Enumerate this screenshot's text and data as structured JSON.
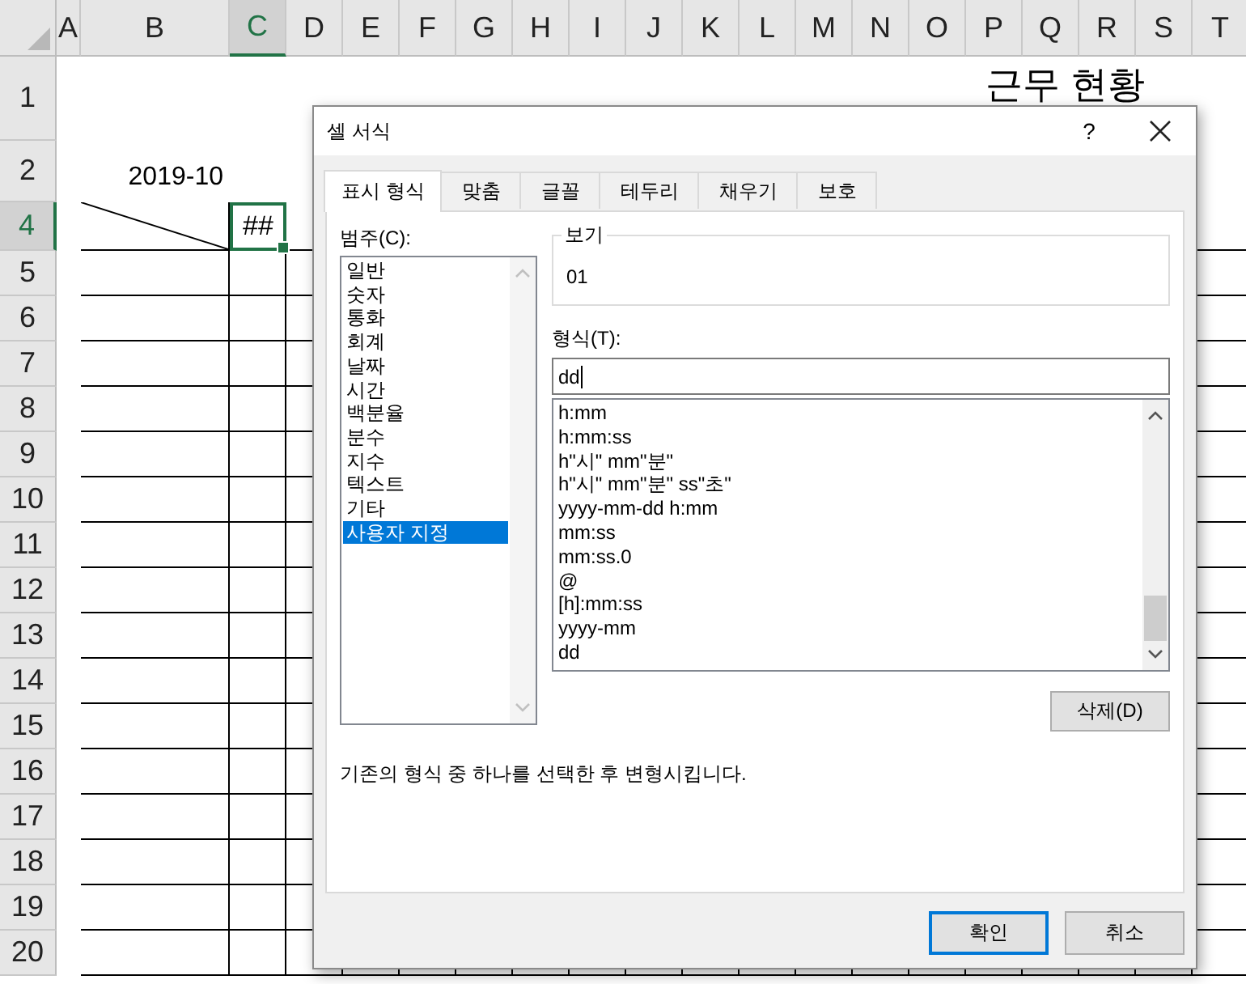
{
  "sheet": {
    "columns": [
      {
        "label": "A",
        "selected": false
      },
      {
        "label": "B",
        "selected": false
      },
      {
        "label": "C",
        "selected": true
      },
      {
        "label": "D",
        "selected": false
      },
      {
        "label": "E",
        "selected": false
      },
      {
        "label": "F",
        "selected": false
      },
      {
        "label": "G",
        "selected": false
      },
      {
        "label": "H",
        "selected": false
      },
      {
        "label": "I",
        "selected": false
      },
      {
        "label": "J",
        "selected": false
      },
      {
        "label": "K",
        "selected": false
      },
      {
        "label": "L",
        "selected": false
      },
      {
        "label": "M",
        "selected": false
      },
      {
        "label": "N",
        "selected": false
      },
      {
        "label": "O",
        "selected": false
      },
      {
        "label": "P",
        "selected": false
      },
      {
        "label": "Q",
        "selected": false
      },
      {
        "label": "R",
        "selected": false
      },
      {
        "label": "S",
        "selected": false
      },
      {
        "label": "T",
        "selected": false
      }
    ],
    "rows": [
      {
        "label": "1",
        "selected": false
      },
      {
        "label": "2",
        "selected": false
      },
      {
        "label": "4",
        "selected": true
      },
      {
        "label": "5",
        "selected": false
      },
      {
        "label": "6",
        "selected": false
      },
      {
        "label": "7",
        "selected": false
      },
      {
        "label": "8",
        "selected": false
      },
      {
        "label": "9",
        "selected": false
      },
      {
        "label": "10",
        "selected": false
      },
      {
        "label": "11",
        "selected": false
      },
      {
        "label": "12",
        "selected": false
      },
      {
        "label": "13",
        "selected": false
      },
      {
        "label": "14",
        "selected": false
      },
      {
        "label": "15",
        "selected": false
      },
      {
        "label": "16",
        "selected": false
      },
      {
        "label": "17",
        "selected": false
      },
      {
        "label": "18",
        "selected": false
      },
      {
        "label": "19",
        "selected": false
      },
      {
        "label": "20",
        "selected": false
      }
    ],
    "title": "근무 현황",
    "month": "2019-10",
    "active_cell": "##"
  },
  "dialog": {
    "title": "셀 서식",
    "help": "?",
    "tabs": [
      {
        "label": "표시 형식",
        "selected": true
      },
      {
        "label": "맞춤",
        "selected": false
      },
      {
        "label": "글꼴",
        "selected": false
      },
      {
        "label": "테두리",
        "selected": false
      },
      {
        "label": "채우기",
        "selected": false
      },
      {
        "label": "보호",
        "selected": false
      }
    ],
    "category_label": "범주(C):",
    "categories": [
      {
        "label": "일반",
        "selected": false
      },
      {
        "label": "숫자",
        "selected": false
      },
      {
        "label": "통화",
        "selected": false
      },
      {
        "label": "회계",
        "selected": false
      },
      {
        "label": "날짜",
        "selected": false
      },
      {
        "label": "시간",
        "selected": false
      },
      {
        "label": "백분율",
        "selected": false
      },
      {
        "label": "분수",
        "selected": false
      },
      {
        "label": "지수",
        "selected": false
      },
      {
        "label": "텍스트",
        "selected": false
      },
      {
        "label": "기타",
        "selected": false
      },
      {
        "label": "사용자 지정",
        "selected": true
      }
    ],
    "preview": {
      "legend": "보기",
      "value": "01"
    },
    "format_label": "형식(T):",
    "format_value": "dd",
    "formats": [
      "h:mm",
      "h:mm:ss",
      "h\"시\" mm\"분\"",
      "h\"시\" mm\"분\" ss\"초\"",
      "yyyy-mm-dd h:mm",
      "mm:ss",
      "mm:ss.0",
      "@",
      "[h]:mm:ss",
      "yyyy-mm",
      "dd"
    ],
    "delete_button": "삭제(D)",
    "description": "기존의 형식 중 하나를 선택한 후 변형시킵니다.",
    "buttons": [
      {
        "label": "확인",
        "default": true
      },
      {
        "label": "취소",
        "default": false
      }
    ]
  }
}
